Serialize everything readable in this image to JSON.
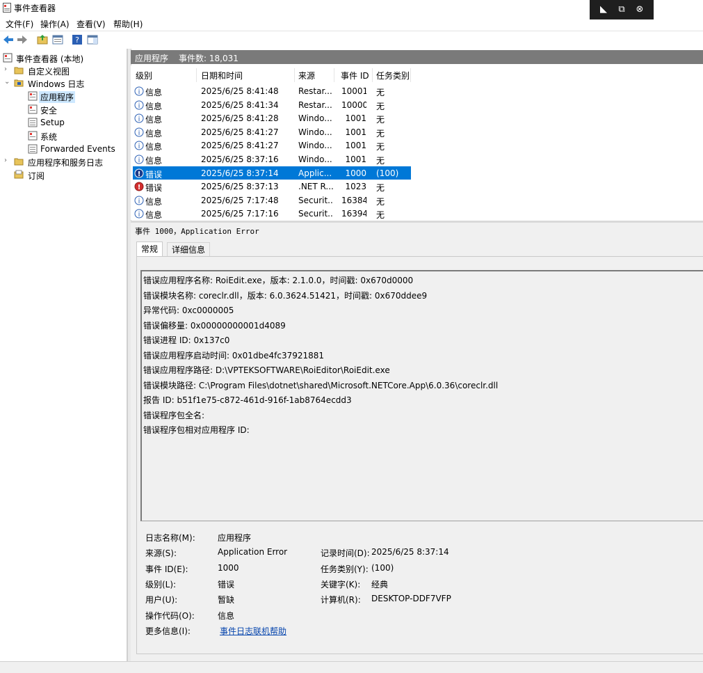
{
  "window": {
    "title": "事件查看器"
  },
  "menu": [
    "文件(F)",
    "操作(A)",
    "查看(V)",
    "帮助(H)"
  ],
  "tree": {
    "root": "事件查看器 (本地)",
    "custom_views": "自定义视图",
    "windows_logs": "Windows 日志",
    "application": "应用程序",
    "security": "安全",
    "setup": "Setup",
    "system": "系统",
    "forwarded": "Forwarded Events",
    "app_service_logs": "应用程序和服务日志",
    "subscriptions": "订阅"
  },
  "header": {
    "log_name": "应用程序",
    "event_count": "事件数: 18,031"
  },
  "columns": [
    "级别",
    "日期和时间",
    "来源",
    "事件 ID",
    "任务类别"
  ],
  "rows": [
    {
      "level": "信息",
      "icon": "info-icon",
      "date": "2025/6/25 8:41:48",
      "source": "Restar...",
      "id": "10001",
      "task": "无"
    },
    {
      "level": "信息",
      "icon": "info-icon",
      "date": "2025/6/25 8:41:34",
      "source": "Restar...",
      "id": "10000",
      "task": "无"
    },
    {
      "level": "信息",
      "icon": "info-icon",
      "date": "2025/6/25 8:41:28",
      "source": "Windo...",
      "id": "1001",
      "task": "无"
    },
    {
      "level": "信息",
      "icon": "info-icon",
      "date": "2025/6/25 8:41:27",
      "source": "Windo...",
      "id": "1001",
      "task": "无"
    },
    {
      "level": "信息",
      "icon": "info-icon",
      "date": "2025/6/25 8:41:27",
      "source": "Windo...",
      "id": "1001",
      "task": "无"
    },
    {
      "level": "信息",
      "icon": "info-icon",
      "date": "2025/6/25 8:37:16",
      "source": "Windo...",
      "id": "1001",
      "task": "无"
    },
    {
      "level": "错误",
      "icon": "error-icon",
      "date": "2025/6/25 8:37:14",
      "source": "Applic...",
      "id": "1000",
      "task": "(100)",
      "selected": true
    },
    {
      "level": "错误",
      "icon": "error-icon",
      "date": "2025/6/25 8:37:13",
      "source": ".NET R...",
      "id": "1023",
      "task": "无"
    },
    {
      "level": "信息",
      "icon": "info-icon",
      "date": "2025/6/25 7:17:48",
      "source": "Securit...",
      "id": "16384",
      "task": "无"
    },
    {
      "level": "信息",
      "icon": "info-icon",
      "date": "2025/6/25 7:17:16",
      "source": "Securit...",
      "id": "16394",
      "task": "无"
    }
  ],
  "detail": {
    "title": "事件 1000，Application Error",
    "tabs": [
      "常规",
      "详细信息"
    ],
    "description": [
      "错误应用程序名称: RoiEdit.exe，版本: 2.1.0.0，时间戳: 0x670d0000",
      "错误模块名称: coreclr.dll，版本: 6.0.3624.51421，时间戳: 0x670ddee9",
      "异常代码: 0xc0000005",
      "错误偏移量: 0x00000000001d4089",
      "错误进程 ID: 0x137c0",
      "错误应用程序启动时间: 0x01dbe4fc37921881",
      "错误应用程序路径: D:\\VPTEKSOFTWARE\\RoiEditor\\RoiEdit.exe",
      "错误模块路径: C:\\Program Files\\dotnet\\shared\\Microsoft.NETCore.App\\6.0.36\\coreclr.dll",
      "报告 ID: b51f1e75-c872-461d-916f-1ab8764ecdd3",
      "错误程序包全名:",
      "错误程序包相对应用程序 ID:"
    ],
    "props": {
      "log_name_label": "日志名称(M):",
      "log_name": "应用程序",
      "source_label": "来源(S):",
      "source": "Application Error",
      "logged_label": "记录时间(D):",
      "logged": "2025/6/25 8:37:14",
      "event_id_label": "事件 ID(E):",
      "event_id": "1000",
      "task_label": "任务类别(Y):",
      "task": "(100)",
      "level_label": "级别(L):",
      "level": "错误",
      "keywords_label": "关键字(K):",
      "keywords": "经典",
      "user_label": "用户(U):",
      "user": "暂缺",
      "computer_label": "计算机(R):",
      "computer": "DESKTOP-DDF7VFP",
      "opcode_label": "操作代码(O):",
      "opcode": "信息",
      "more_info_label": "更多信息(I):",
      "more_info_link": "事件日志联机帮助"
    }
  }
}
